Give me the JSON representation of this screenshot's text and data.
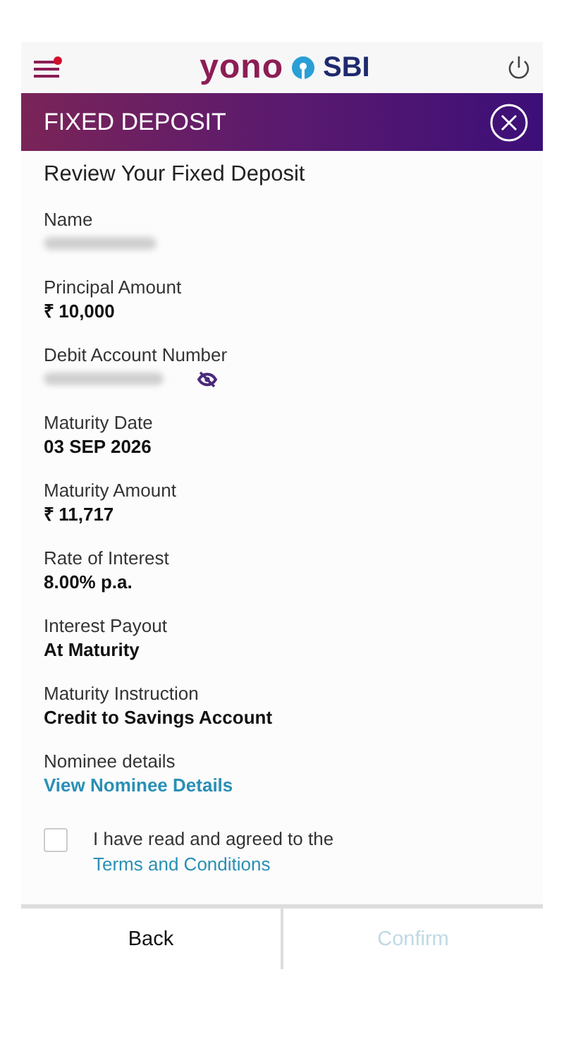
{
  "header": {
    "logo": {
      "word": "yono",
      "brand": "SBI"
    },
    "menu_badge": true
  },
  "banner": {
    "title": "FIXED DEPOSIT"
  },
  "review": {
    "title": "Review Your Fixed Deposit",
    "fields": [
      {
        "label": "Name",
        "kind": "masked",
        "toggle": false
      },
      {
        "label": "Principal Amount",
        "kind": "text",
        "value": "₹ 10,000"
      },
      {
        "label": "Debit Account Number",
        "kind": "masked",
        "toggle": true
      },
      {
        "label": "Maturity Date",
        "kind": "text",
        "value": "03 SEP 2026"
      },
      {
        "label": "Maturity Amount",
        "kind": "text",
        "value": "₹ 11,717"
      },
      {
        "label": "Rate of Interest",
        "kind": "text",
        "value": "8.00% p.a."
      },
      {
        "label": "Interest Payout",
        "kind": "text",
        "value": "At Maturity"
      },
      {
        "label": "Maturity Instruction",
        "kind": "text",
        "value": "Credit to Savings Account"
      },
      {
        "label": "Nominee details",
        "kind": "link",
        "value": "View Nominee Details"
      }
    ]
  },
  "agreement": {
    "checked": false,
    "text": "I have read and agreed to the",
    "link": "Terms and Conditions"
  },
  "buttons": [
    {
      "label": "Back",
      "disabled": false
    },
    {
      "label": "Confirm",
      "disabled": true
    }
  ]
}
